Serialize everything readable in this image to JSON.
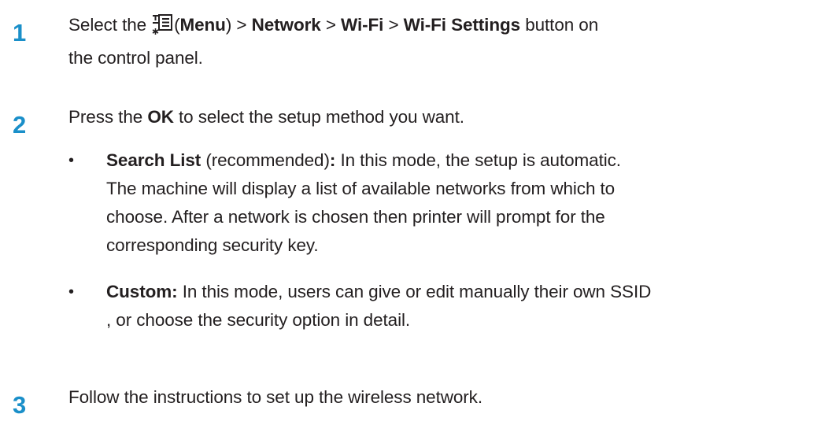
{
  "steps": [
    {
      "number": "1",
      "parts": {
        "select": "Select the",
        "menu": "Menu",
        "network": "Network",
        "wifi": "Wi-Fi",
        "wifi_settings": "Wi-Fi Settings",
        "tail1": "button on",
        "tail2": "the control panel."
      }
    },
    {
      "number": "2",
      "parts": {
        "press": "Press the",
        "ok": "OK",
        "rest": "to select the setup method you want."
      },
      "bullets": [
        {
          "bullet": "•",
          "term": "Search List",
          "qualifier": "(recommended)",
          "colon": ":",
          "description_lines": [
            "In this mode, the setup is automatic.",
            "The machine will display a list of available networks from which to",
            "choose. After a network is chosen then printer will prompt for the",
            "corresponding security key."
          ]
        },
        {
          "bullet": "•",
          "term": "Custom:",
          "description_lines": [
            "In this mode, users can give or edit manually their own SSID",
            ", or choose the security option in detail."
          ]
        }
      ]
    },
    {
      "number": "3",
      "parts": {
        "text": "Follow the instructions to set up the wireless network."
      }
    }
  ],
  "icons": {
    "menu_icon": "menu-icon"
  },
  "colors": {
    "step_number": "#1a8fc9",
    "text": "#231f20"
  }
}
